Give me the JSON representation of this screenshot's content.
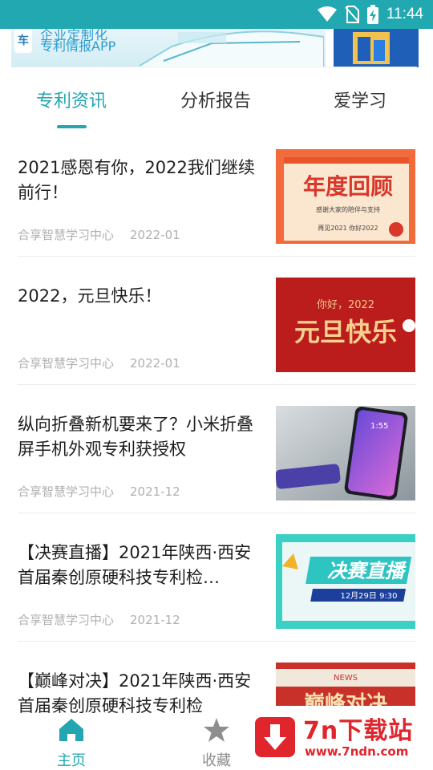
{
  "status_bar": {
    "time": "11:44",
    "icons": [
      "wifi-icon",
      "no-sim-icon",
      "battery-charging-icon"
    ]
  },
  "banner": {
    "logo_char": "车",
    "line1": "企业定制化",
    "line2": "专利情报APP"
  },
  "tabs": [
    {
      "label": "专利资讯",
      "active": true
    },
    {
      "label": "分析报告",
      "active": false
    },
    {
      "label": "爱学习",
      "active": false
    }
  ],
  "news": [
    {
      "title": "2021感恩有你，2022我们继续前行！",
      "source": "合享智慧学习中心",
      "date": "2022-01",
      "thumb": {
        "heading": "年度回顾",
        "sub": "感谢大家的陪伴与支持",
        "note": "再见2021 你好2022"
      }
    },
    {
      "title": "2022，元旦快乐！",
      "source": "合享智慧学习中心",
      "date": "2022-01",
      "thumb": {
        "heading": "元旦快乐",
        "sub": "你好，2022"
      }
    },
    {
      "title": "纵向折叠新机要来了？小米折叠屏手机外观专利获授权",
      "source": "合享智慧学习中心",
      "date": "2021-12",
      "thumb": {
        "time": "1:55"
      }
    },
    {
      "title": "【决赛直播】2021年陕西·西安首届秦创原硬科技专利检…",
      "source": "合享智慧学习中心",
      "date": "2021-12",
      "thumb": {
        "heading": "决赛直播",
        "sub": "12月29日 9:30"
      }
    },
    {
      "title": "【巅峰对决】2021年陕西·西安首届秦创原硬科技专利检",
      "source": "",
      "date": "",
      "thumb": {
        "tag": "NEWS",
        "heading": "巅峰对决"
      }
    }
  ],
  "bottom_nav": [
    {
      "label": "主页",
      "icon": "home-icon",
      "active": true
    },
    {
      "label": "收藏",
      "icon": "star-icon",
      "active": false
    }
  ],
  "watermark": {
    "title": "7n下载站",
    "url": "www.7ndn.com"
  },
  "colors": {
    "accent": "#23a6b1",
    "status_bar": "#21a8b0",
    "meta_text": "#b0b0b0",
    "watermark_red": "#e0252c"
  }
}
